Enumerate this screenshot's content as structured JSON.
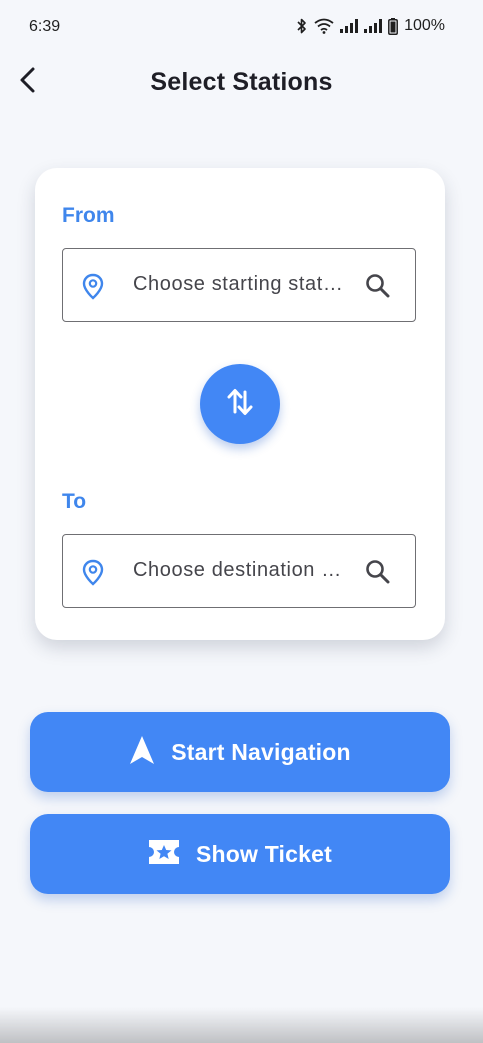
{
  "status_bar": {
    "time": "6:39",
    "battery": "100%",
    "icons": [
      "bluetooth-icon",
      "wifi-icon",
      "signal-icon",
      "signal-icon",
      "battery-icon"
    ]
  },
  "app_bar": {
    "title": "Select Stations",
    "back_icon": "chevron-left-icon"
  },
  "card": {
    "from": {
      "label": "From",
      "placeholder": "Choose starting station",
      "leading_icon": "location-pin-icon",
      "trailing_icon": "search-icon"
    },
    "swap_icon": "swap-vertical-icon",
    "to": {
      "label": "To",
      "placeholder": "Choose destination station",
      "leading_icon": "location-pin-icon",
      "trailing_icon": "search-icon"
    }
  },
  "actions": {
    "start_navigation": {
      "label": "Start Navigation",
      "icon": "navigation-arrow-icon"
    },
    "show_ticket": {
      "label": "Show Ticket",
      "icon": "ticket-icon"
    }
  },
  "colors": {
    "accent": "#4287f5",
    "label_blue": "#3f86ec",
    "background": "#f5f7fb",
    "card": "#ffffff",
    "title_text": "#1e1e26"
  }
}
